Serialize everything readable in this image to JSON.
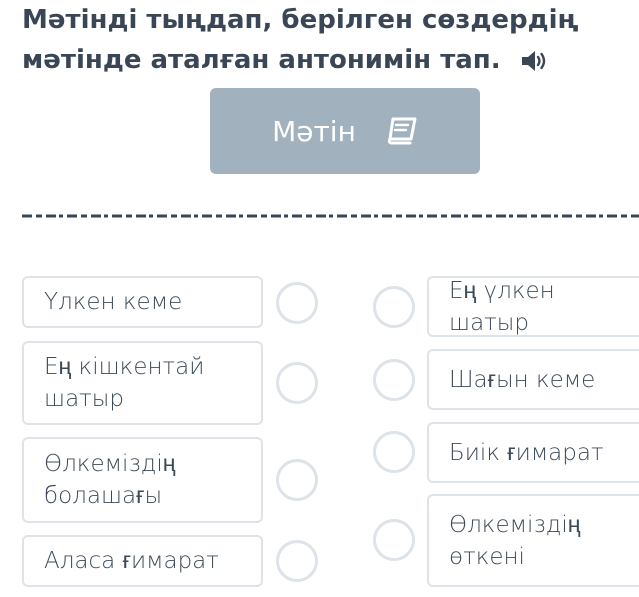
{
  "question": {
    "line1": "Мәтінді тыңдап, берілген сөздердің",
    "line2": "мәтінде аталған антонимін тап."
  },
  "text_button": {
    "label": "Мәтін"
  },
  "left_items": [
    "Үлкен кеме",
    "Ең кішкентай\nшатыр",
    "Өлкеміздің\nболашағы",
    "Аласа ғимарат"
  ],
  "right_items": [
    "Ең үлкен шатыр",
    "Шағын кеме",
    "Биік ғимарат",
    "Өлкеміздің\nөткені"
  ],
  "colors": {
    "button_bg": "#a1b1bd",
    "card_border": "#dde3e8",
    "title_text": "#3a4556"
  },
  "icons": {
    "audio": "speaker-icon",
    "book": "book-icon"
  }
}
